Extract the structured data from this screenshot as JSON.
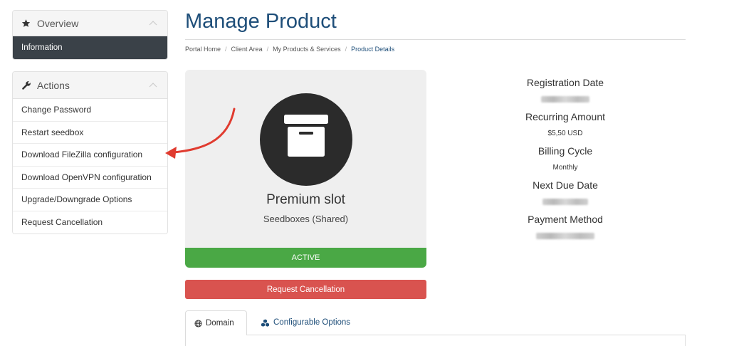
{
  "sidebar": {
    "overview": {
      "title": "Overview",
      "icon": "star-icon",
      "items": [
        {
          "label": "Information",
          "active": true
        }
      ]
    },
    "actions": {
      "title": "Actions",
      "icon": "wrench-icon",
      "items": [
        {
          "label": "Change Password"
        },
        {
          "label": "Restart seedbox"
        },
        {
          "label": "Download FileZilla configuration"
        },
        {
          "label": "Download OpenVPN configuration"
        },
        {
          "label": "Upgrade/Downgrade Options"
        },
        {
          "label": "Request Cancellation"
        }
      ]
    }
  },
  "header": {
    "title": "Manage Product",
    "breadcrumb": [
      "Portal Home",
      "Client Area",
      "My Products & Services",
      "Product Details"
    ]
  },
  "product": {
    "icon": "archive-box-icon",
    "name": "Premium slot",
    "group": "Seedboxes (Shared)",
    "status": "ACTIVE",
    "cancel_label": "Request Cancellation"
  },
  "info": {
    "registration_date_label": "Registration Date",
    "recurring_amount_label": "Recurring Amount",
    "recurring_amount": "$5,50 USD",
    "billing_cycle_label": "Billing Cycle",
    "billing_cycle": "Monthly",
    "next_due_date_label": "Next Due Date",
    "payment_method_label": "Payment Method"
  },
  "tabs": [
    {
      "label": "Domain",
      "icon": "globe-icon",
      "active": true
    },
    {
      "label": "Configurable Options",
      "icon": "cubes-icon",
      "active": false
    }
  ],
  "colors": {
    "primary": "#1e4e79",
    "active_status": "#4aa845",
    "danger": "#d9534f",
    "sidebar_active": "#3a4148",
    "annotation_arrow": "#e03b2f"
  }
}
